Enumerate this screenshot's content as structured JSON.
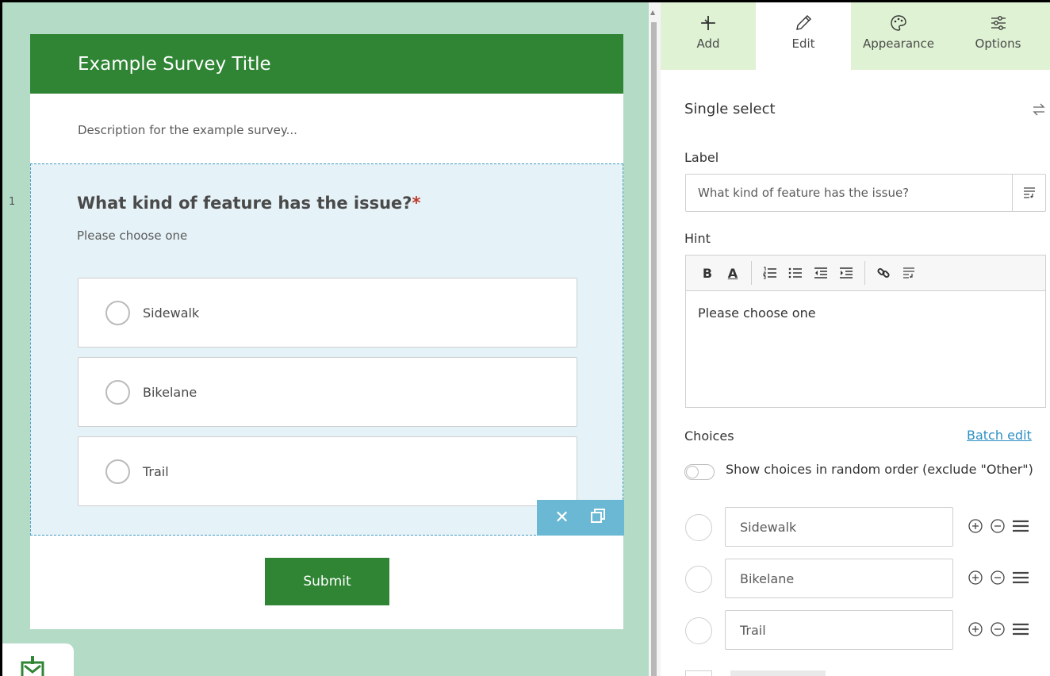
{
  "survey": {
    "title": "Example Survey Title",
    "description": "Description for the example survey...",
    "question_number": "1",
    "question": {
      "title": "What kind of feature has the issue?",
      "required_mark": "*",
      "hint": "Please choose one",
      "choices": [
        "Sidewalk",
        "Bikelane",
        "Trail"
      ]
    },
    "actions": {
      "delete_icon": "✕",
      "duplicate_icon": "❐"
    },
    "submit_label": "Submit"
  },
  "panel": {
    "tabs": [
      {
        "label": "Add",
        "icon": "plus-icon"
      },
      {
        "label": "Edit",
        "icon": "pencil-icon"
      },
      {
        "label": "Appearance",
        "icon": "palette-icon"
      },
      {
        "label": "Options",
        "icon": "sliders-icon"
      }
    ],
    "active_tab": "Edit",
    "field_type": "Single select",
    "label_section": "Label",
    "label_value": "What kind of feature has the issue?",
    "hint_section": "Hint",
    "hint_value": "Please choose one",
    "hint_toolbar": {
      "bold": "B",
      "color": "A"
    },
    "choices_section": "Choices",
    "batch_edit": "Batch edit",
    "random_order_text": "Show choices in random order (exclude \"Other\")",
    "random_order_enabled": false,
    "choices": [
      "Sidewalk",
      "Bikelane",
      "Trail"
    ]
  },
  "colors": {
    "header_green": "#2f8534",
    "canvas_bg": "#b3dbc6",
    "tab_bg": "#dff2d3",
    "selection_blue": "#6ab8d3",
    "link_blue": "#2e90c4"
  }
}
